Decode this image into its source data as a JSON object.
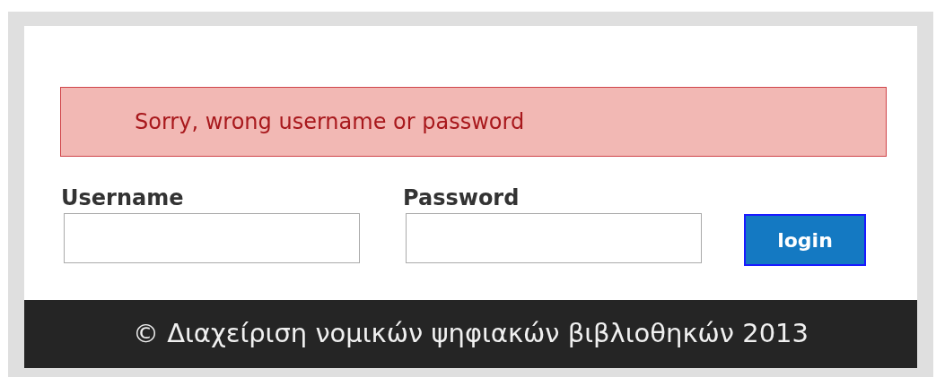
{
  "error_message": "Sorry, wrong username or password",
  "fields": [
    {
      "label": "Username"
    },
    {
      "label": "Password"
    }
  ],
  "login_button": "login",
  "footer": "© Διαχείριση νομικών ψηφιακών βιβλιοθηκών 2013"
}
